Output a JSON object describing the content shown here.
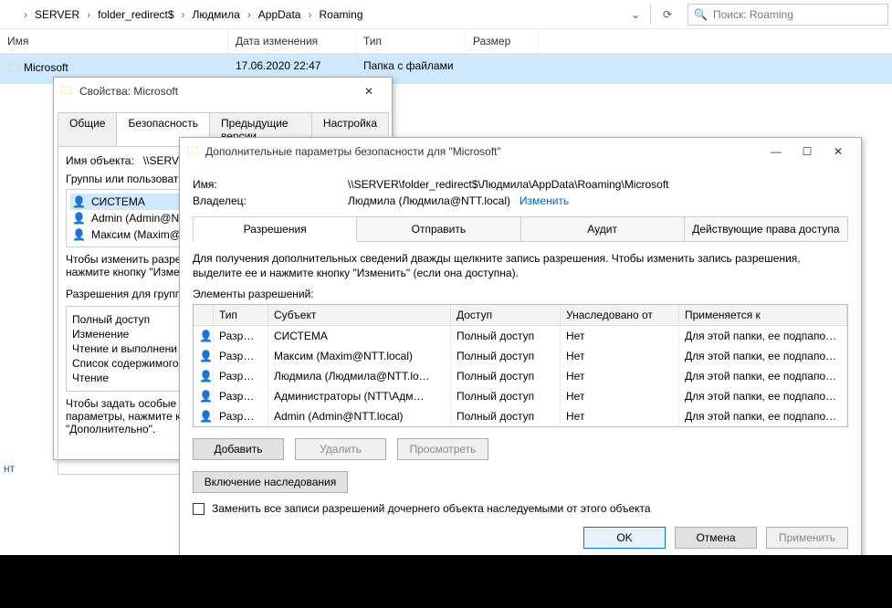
{
  "explorer": {
    "breadcrumbs": [
      "SERVER",
      "folder_redirect$",
      "Людмила",
      "AppData",
      "Roaming"
    ],
    "search_placeholder": "Поиск: Roaming",
    "columns": {
      "name": "Имя",
      "date": "Дата изменения",
      "type": "Тип",
      "size": "Размер"
    },
    "row": {
      "name": "Microsoft",
      "date": "17.06.2020 22:47",
      "type": "Папка с файлами",
      "size": ""
    }
  },
  "link_text": "нт",
  "props": {
    "title": "Свойства: Microsoft",
    "tabs": [
      "Общие",
      "Безопасность",
      "Предыдущие версии",
      "Настройка"
    ],
    "active_tab": 1,
    "object_label": "Имя объекта:",
    "object_value": "\\\\SERVER\\f…",
    "groups_label": "Группы или пользоват",
    "users": [
      "СИСТЕМА",
      "Admin (Admin@NTT",
      "Максим (Maxim@N"
    ],
    "change_hint_1": "Чтобы изменить разре",
    "change_hint_2": "нажмите кнопку \"Изме",
    "perm_for": "Разрешения для групп",
    "perms": [
      "Полный доступ",
      "Изменение",
      "Чтение и выполнени",
      "Список содержимого",
      "Чтение"
    ],
    "special_1": "Чтобы задать особые р",
    "special_2": "параметры, нажмите к",
    "special_3": "\"Дополнительно\"."
  },
  "adv": {
    "title": "Дополнительные параметры безопасности для \"Microsoft\"",
    "name_label": "Имя:",
    "name_value": "\\\\SERVER\\folder_redirect$\\Людмила\\AppData\\Roaming\\Microsoft",
    "owner_label": "Владелец:",
    "owner_value": "Людмила (Людмила@NTT.local)",
    "owner_change": "Изменить",
    "tabs": [
      "Разрешения",
      "Отправить",
      "Аудит",
      "Действующие права доступа"
    ],
    "active_tab": 0,
    "instr": "Для получения дополнительных сведений дважды щелкните запись разрешения. Чтобы изменить запись разрешения, выделите ее и нажмите кнопку \"Изменить\" (если она доступна).",
    "elements_label": "Элементы разрешений:",
    "headers": {
      "type": "Тип",
      "subject": "Субъект",
      "access": "Доступ",
      "inherited": "Унаследовано от",
      "applies": "Применяется к"
    },
    "rows": [
      {
        "type": "Разр…",
        "subject": "СИСТЕМА",
        "access": "Полный доступ",
        "inherited": "Нет",
        "applies": "Для этой папки, ее подпапок …"
      },
      {
        "type": "Разр…",
        "subject": "Максим (Maxim@NTT.local)",
        "access": "Полный доступ",
        "inherited": "Нет",
        "applies": "Для этой папки, ее подпапок …"
      },
      {
        "type": "Разр…",
        "subject": "Людмила (Людмила@NTT.lo…",
        "access": "Полный доступ",
        "inherited": "Нет",
        "applies": "Для этой папки, ее подпапок …"
      },
      {
        "type": "Разр…",
        "subject": "Администраторы (NTT\\Адм…",
        "access": "Полный доступ",
        "inherited": "Нет",
        "applies": "Для этой папки, ее подпапок …"
      },
      {
        "type": "Разр…",
        "subject": "Admin (Admin@NTT.local)",
        "access": "Полный доступ",
        "inherited": "Нет",
        "applies": "Для этой папки, ее подпапок …"
      }
    ],
    "btn_add": "Добавить",
    "btn_del": "Удалить",
    "btn_view": "Просмотреть",
    "btn_inherit": "Включение наследования",
    "chk_replace": "Заменить все записи разрешений дочернего объекта наследуемыми от этого объекта",
    "ok": "OK",
    "cancel": "Отмена",
    "apply": "Применить"
  }
}
